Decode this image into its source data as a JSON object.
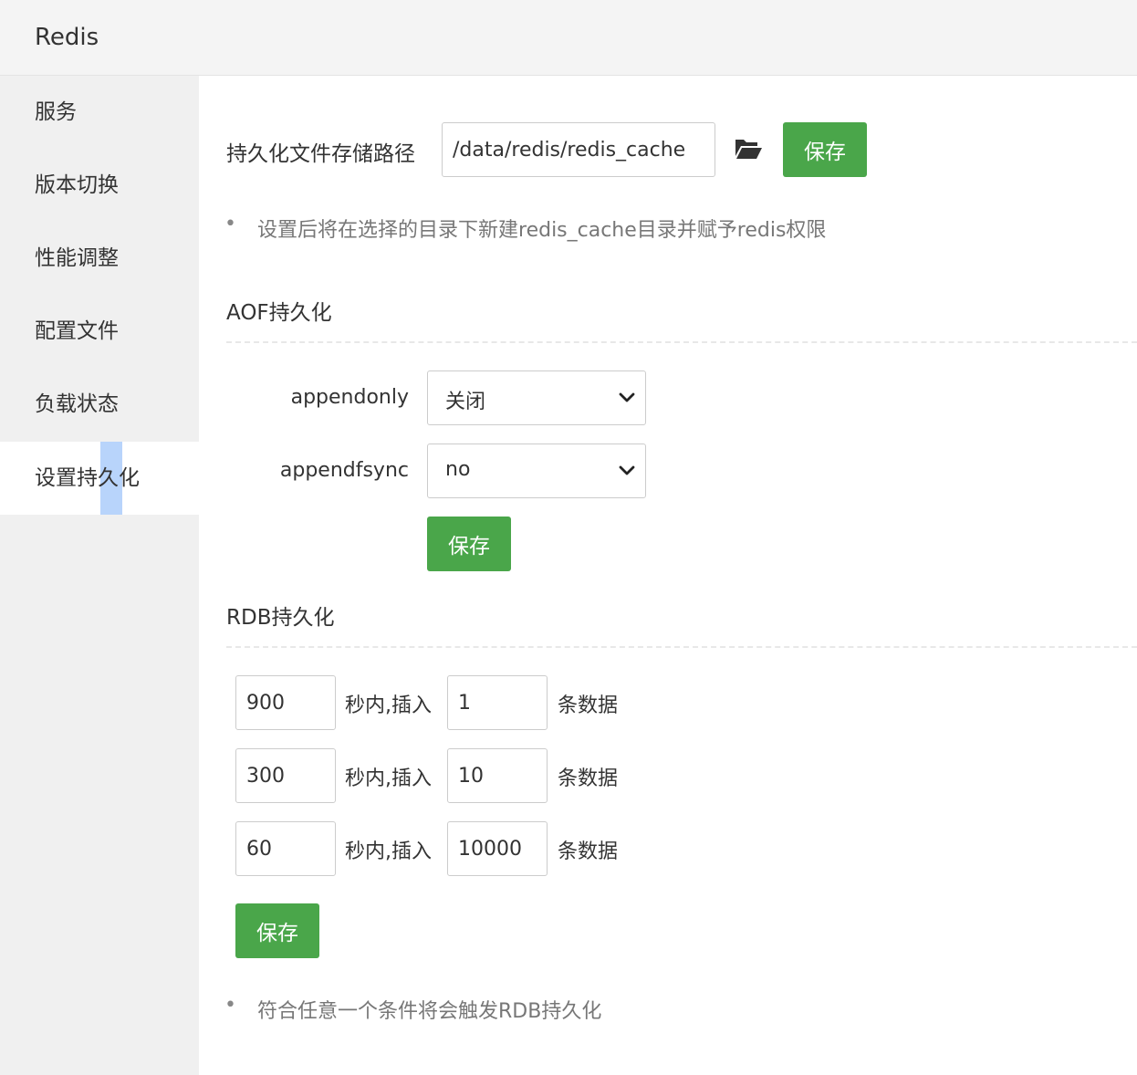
{
  "app": {
    "title": "Redis"
  },
  "sidebar": {
    "items": [
      {
        "label": "服务"
      },
      {
        "label": "版本切换"
      },
      {
        "label": "性能调整"
      },
      {
        "label": "配置文件"
      },
      {
        "label": "负载状态"
      },
      {
        "label": "设置持久化",
        "active": true
      }
    ]
  },
  "storage": {
    "label": "持久化文件存储路径",
    "path_value": "/data/redis/redis_cache",
    "folder_icon": "folder-open-icon",
    "save_label": "保存",
    "note": "设置后将在选择的目录下新建redis_cache目录并赋予redis权限"
  },
  "aof": {
    "title": "AOF持久化",
    "appendonly_label": "appendonly",
    "appendonly_value": "关闭",
    "appendfsync_label": "appendfsync",
    "appendfsync_value": "no",
    "save_label": "保存"
  },
  "rdb": {
    "title": "RDB持久化",
    "within_label": "秒内,插入",
    "records_label": "条数据",
    "rules": [
      {
        "seconds": "900",
        "changes": "1"
      },
      {
        "seconds": "300",
        "changes": "10"
      },
      {
        "seconds": "60",
        "changes": "10000"
      }
    ],
    "save_label": "保存",
    "note": "符合任意一个条件将会触发RDB持久化"
  },
  "colors": {
    "accent_green": "#4aa64a",
    "sidebar_bg": "#f0f0f0",
    "selection": "#b8d4fb"
  }
}
